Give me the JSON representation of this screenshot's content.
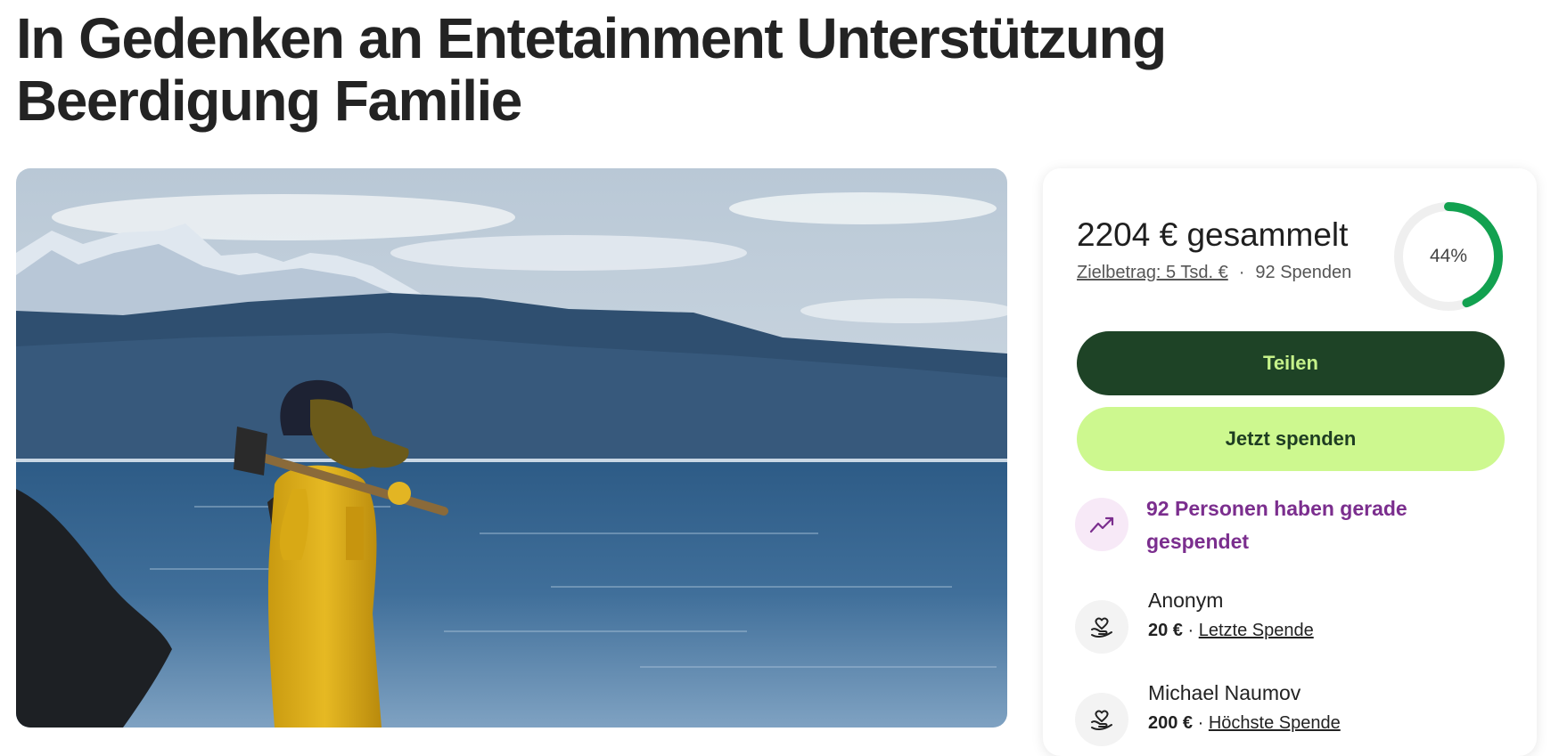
{
  "page": {
    "title": "In Gedenken an Entetainment Unterstützung Beerdigung Familie"
  },
  "campaign": {
    "raised_amount": "2204 €",
    "raised_label": "gesammelt",
    "goal_text": "Zielbetrag: 5 Tsd. €",
    "separator": "·",
    "donation_count": "92 Spenden",
    "progress_percent_text": "44%",
    "progress_fraction": 0.44
  },
  "buttons": {
    "share_label": "Teilen",
    "donate_label": "Jetzt spenden"
  },
  "trend": {
    "icon": "trending-up-icon",
    "text": "92 Personen haben gerade gespendet"
  },
  "donors": [
    {
      "name": "Anonym",
      "amount": "20 €",
      "separator": "·",
      "tag": "Letzte Spende",
      "icon": "heart-hand-icon"
    },
    {
      "name": "Michael Naumov",
      "amount": "200 €",
      "separator": "·",
      "tag": "Höchste Spende",
      "icon": "heart-hand-icon"
    }
  ],
  "colors": {
    "share_bg": "#1e4326",
    "share_text": "#c6f28a",
    "donate_bg": "#cdf88f",
    "progress": "#12a150",
    "trend_text": "#7b2e8e"
  }
}
